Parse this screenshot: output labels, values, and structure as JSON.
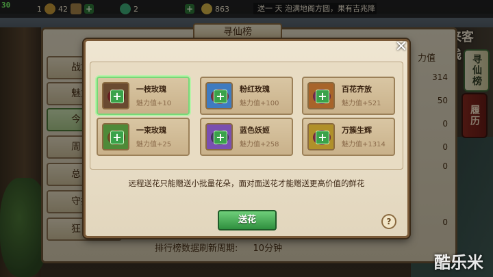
{
  "fps": "30",
  "topbar": {
    "level": "1",
    "gold": "42",
    "jade": "2",
    "coins": "863",
    "notice": "送一 天 泡满地阁方圆，果有吉兆降"
  },
  "game_logo": "悦来客栈",
  "right_tabs": {
    "active": "寻仙榜",
    "other": "履历"
  },
  "panel": {
    "title": "寻仙榜",
    "side_tabs": [
      "战力",
      "魅力",
      "今日",
      "周",
      "总",
      "守护",
      "狂"
    ],
    "col_head": "力值",
    "values": [
      "314",
      "50",
      "0",
      "0",
      "0",
      "0"
    ],
    "refresh_label": "排行榜数据刷新周期:",
    "refresh_value": "10分钟"
  },
  "modal": {
    "close": "✕",
    "gifts": [
      {
        "name": "一枝玫瑰",
        "value": "魅力值+10",
        "color": "#c2292e",
        "frame": "#6a4a30",
        "selected": true
      },
      {
        "name": "粉红玫瑰",
        "value": "魅力值+100",
        "color": "#e05a7a",
        "frame": "#3f7bc0",
        "selected": false
      },
      {
        "name": "百花齐放",
        "value": "魅力值+521",
        "color": "#d04ab0",
        "frame": "#a8642a",
        "selected": false
      },
      {
        "name": "一束玫瑰",
        "value": "魅力值+25",
        "color": "#d8b040",
        "frame": "#4f8a38",
        "selected": false
      },
      {
        "name": "蓝色妖姬",
        "value": "魅力值+258",
        "color": "#4a6ad8",
        "frame": "#7a4fb0",
        "selected": false
      },
      {
        "name": "万簇生辉",
        "value": "魅力值+1314",
        "color": "#e04a8a",
        "frame": "#b0902a",
        "selected": false
      }
    ],
    "hint": "远程送花只能赠送小批量花朵，面对面送花才能赠送更高价值的鲜花",
    "send_label": "送花",
    "help_label": "?"
  },
  "watermark": "酷乐米"
}
